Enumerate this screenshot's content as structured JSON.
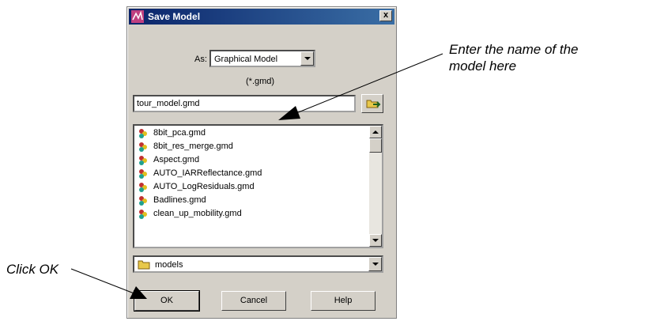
{
  "dialog": {
    "title": "Save Model",
    "close_label": "x",
    "as_label": "As:",
    "as_value": "Graphical Model",
    "filter_text": "(*.gmd)",
    "filename_value": "tour_model.gmd",
    "files": [
      {
        "name": "8bit_pca.gmd",
        "icon": "model-file-icon"
      },
      {
        "name": "8bit_res_merge.gmd",
        "icon": "model-file-icon"
      },
      {
        "name": "Aspect.gmd",
        "icon": "model-file-icon"
      },
      {
        "name": "AUTO_IARReflectance.gmd",
        "icon": "model-file-icon"
      },
      {
        "name": "AUTO_LogResiduals.gmd",
        "icon": "model-file-icon"
      },
      {
        "name": "Badlines.gmd",
        "icon": "model-file-icon"
      },
      {
        "name": "clean_up_mobility.gmd",
        "icon": "model-file-icon"
      }
    ],
    "folder_value": "models",
    "ok_label": "OK",
    "cancel_label": "Cancel",
    "help_label": "Help"
  },
  "annotations": {
    "enter_name_line1": "Enter the name of the",
    "enter_name_line2": "model here",
    "click_ok": "Click OK"
  },
  "colors": {
    "dialog_bg": "#d4d0c8",
    "titlebar": "#0a246a"
  }
}
